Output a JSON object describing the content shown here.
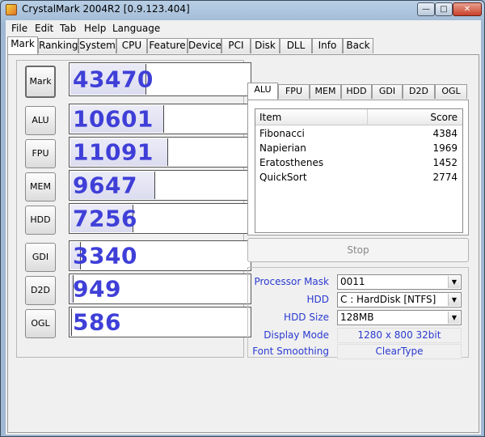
{
  "window": {
    "title": "CrystalMark 2004R2 [0.9.123.404]"
  },
  "menu": [
    "File",
    "Edit",
    "Tab",
    "Help",
    "Language"
  ],
  "tabs": [
    "Mark",
    "Ranking",
    "System",
    "CPU",
    "Feature",
    "Device",
    "PCI",
    "Disk",
    "DLL",
    "Info",
    "Back"
  ],
  "scores": [
    {
      "label": "Mark",
      "value": "43470",
      "fill": 0.42
    },
    {
      "label": "ALU",
      "value": "10601",
      "fill": 0.52
    },
    {
      "label": "FPU",
      "value": "11091",
      "fill": 0.54
    },
    {
      "label": "MEM",
      "value": "9647",
      "fill": 0.47
    },
    {
      "label": "HDD",
      "value": "7256",
      "fill": 0.35
    },
    {
      "label": "GDI",
      "value": "3340",
      "fill": 0.06
    },
    {
      "label": "D2D",
      "value": "949",
      "fill": 0.02
    },
    {
      "label": "OGL",
      "value": "586",
      "fill": 0.01
    }
  ],
  "subtabs": [
    "ALU",
    "FPU",
    "MEM",
    "HDD",
    "GDI",
    "D2D",
    "OGL"
  ],
  "list": {
    "col_item": "Item",
    "col_score": "Score",
    "rows": [
      {
        "name": "Fibonacci",
        "score": "4384"
      },
      {
        "name": "Napierian",
        "score": "1969"
      },
      {
        "name": "Eratosthenes",
        "score": "1452"
      },
      {
        "name": "QuickSort",
        "score": "2774"
      }
    ]
  },
  "stop_label": "Stop",
  "settings": {
    "processor_mask_label": "Processor Mask",
    "processor_mask": "0011",
    "hdd_label": "HDD",
    "hdd": "C : HardDisk [NTFS]",
    "hdd_size_label": "HDD Size",
    "hdd_size": "128MB",
    "display_mode_label": "Display Mode",
    "display_mode": "1280 x 800 32bit",
    "font_smoothing_label": "Font Smoothing",
    "font_smoothing": "ClearType"
  }
}
